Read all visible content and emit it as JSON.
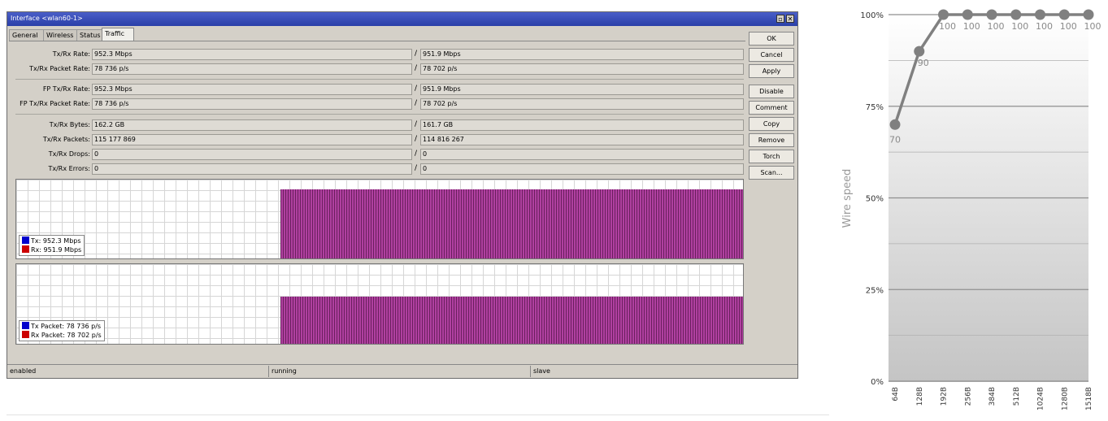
{
  "window": {
    "title": "Interface <wlan60-1>",
    "tabs": [
      "General",
      "Wireless",
      "Status",
      "Traffic"
    ],
    "active_tab": "Traffic"
  },
  "fields": [
    {
      "label": "Tx/Rx Rate:",
      "tx": "952.3 Mbps",
      "rx": "951.9 Mbps"
    },
    {
      "label": "Tx/Rx Packet Rate:",
      "tx": "78 736 p/s",
      "rx": "78 702 p/s"
    },
    {
      "label": "FP Tx/Rx Rate:",
      "tx": "952.3 Mbps",
      "rx": "951.9 Mbps"
    },
    {
      "label": "FP Tx/Rx Packet Rate:",
      "tx": "78 736 p/s",
      "rx": "78 702 p/s"
    },
    {
      "label": "Tx/Rx Bytes:",
      "tx": "162.2 GB",
      "rx": "161.7 GB"
    },
    {
      "label": "Tx/Rx Packets:",
      "tx": "115 177 869",
      "rx": "114 816 267"
    },
    {
      "label": "Tx/Rx Drops:",
      "tx": "0",
      "rx": "0"
    },
    {
      "label": "Tx/Rx Errors:",
      "tx": "0",
      "rx": "0"
    }
  ],
  "separator": "/",
  "graph1": {
    "legend": [
      {
        "label": "Tx:  952.3 Mbps",
        "color": "#0000cc"
      },
      {
        "label": "Rx:  951.9 Mbps",
        "color": "#cc0000"
      }
    ]
  },
  "graph2": {
    "legend": [
      {
        "label": "Tx Packet:  78 736 p/s",
        "color": "#0000cc"
      },
      {
        "label": "Rx Packet:  78 702 p/s",
        "color": "#cc0000"
      }
    ]
  },
  "buttons": [
    "OK",
    "Cancel",
    "Apply",
    "Disable",
    "Comment",
    "Copy",
    "Remove",
    "Torch",
    "Scan..."
  ],
  "status": [
    "enabled",
    "running",
    "slave"
  ],
  "icons": {
    "minimize": "minimize-icon",
    "close": "close-icon"
  },
  "chart_data": {
    "type": "line",
    "categories": [
      "64B",
      "128B",
      "192B",
      "256B",
      "384B",
      "512B",
      "1024B",
      "1280B",
      "1518B"
    ],
    "values": [
      70,
      90,
      100,
      100,
      100,
      100,
      100,
      100,
      100
    ],
    "data_labels": [
      "70",
      "90",
      "100",
      "100",
      "100",
      "100",
      "100",
      "100",
      "100"
    ],
    "ylabel": "Wire speed",
    "yticks": [
      "0%",
      "25%",
      "50%",
      "75%",
      "100%"
    ],
    "ylim": [
      0,
      100
    ],
    "line_color": "#808080"
  }
}
